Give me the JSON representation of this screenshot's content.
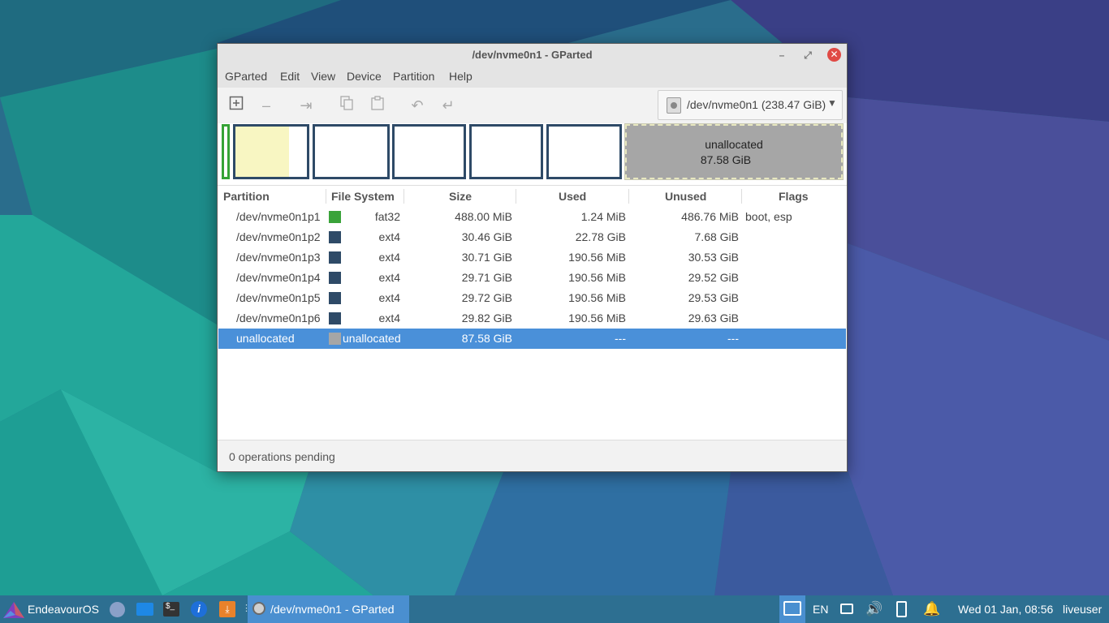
{
  "window": {
    "title": "/dev/nvme0n1 - GParted",
    "menus": [
      "GParted",
      "Edit",
      "View",
      "Device",
      "Partition",
      "Help"
    ],
    "device_selector": "/dev/nvme0n1 (238.47 GiB)",
    "toolbar_icons": [
      "new-partition-icon",
      "delete-partition-icon",
      "resize-move-icon",
      "copy-icon",
      "paste-icon",
      "undo-icon",
      "apply-icon"
    ]
  },
  "graph": {
    "unallocated_label": "unallocated",
    "unallocated_size": "87.58 GiB"
  },
  "table": {
    "headers": {
      "partition": "Partition",
      "filesystem": "File System",
      "size": "Size",
      "used": "Used",
      "unused": "Unused",
      "flags": "Flags"
    },
    "rows": [
      {
        "partition": "/dev/nvme0n1p1",
        "fs": "fat32",
        "size": "488.00 MiB",
        "used": "1.24 MiB",
        "unused": "486.76 MiB",
        "flags": "boot, esp",
        "color": "#3aa33a"
      },
      {
        "partition": "/dev/nvme0n1p2",
        "fs": "ext4",
        "size": "30.46 GiB",
        "used": "22.78 GiB",
        "unused": "7.68 GiB",
        "flags": "",
        "color": "#2e4a67"
      },
      {
        "partition": "/dev/nvme0n1p3",
        "fs": "ext4",
        "size": "30.71 GiB",
        "used": "190.56 MiB",
        "unused": "30.53 GiB",
        "flags": "",
        "color": "#2e4a67"
      },
      {
        "partition": "/dev/nvme0n1p4",
        "fs": "ext4",
        "size": "29.71 GiB",
        "used": "190.56 MiB",
        "unused": "29.52 GiB",
        "flags": "",
        "color": "#2e4a67"
      },
      {
        "partition": "/dev/nvme0n1p5",
        "fs": "ext4",
        "size": "29.72 GiB",
        "used": "190.56 MiB",
        "unused": "29.53 GiB",
        "flags": "",
        "color": "#2e4a67"
      },
      {
        "partition": "/dev/nvme0n1p6",
        "fs": "ext4",
        "size": "29.82 GiB",
        "used": "190.56 MiB",
        "unused": "29.63 GiB",
        "flags": "",
        "color": "#2e4a67"
      },
      {
        "partition": "unallocated",
        "fs": "unallocated",
        "size": "87.58 GiB",
        "used": "---",
        "unused": "---",
        "flags": "",
        "color": "#a6a6a6"
      }
    ]
  },
  "status": "0 operations pending",
  "taskbar": {
    "menu_label": "EndeavourOS",
    "task_label": "/dev/nvme0n1 - GParted",
    "lang": "EN",
    "clock": "Wed 01 Jan, 08:56",
    "user": "liveuser"
  },
  "colors": {
    "selection": "#4a90d9",
    "taskbar": "#2d6f91",
    "ext4": "#2e4a67",
    "fat32": "#3aa33a",
    "close": "#e04a45"
  }
}
